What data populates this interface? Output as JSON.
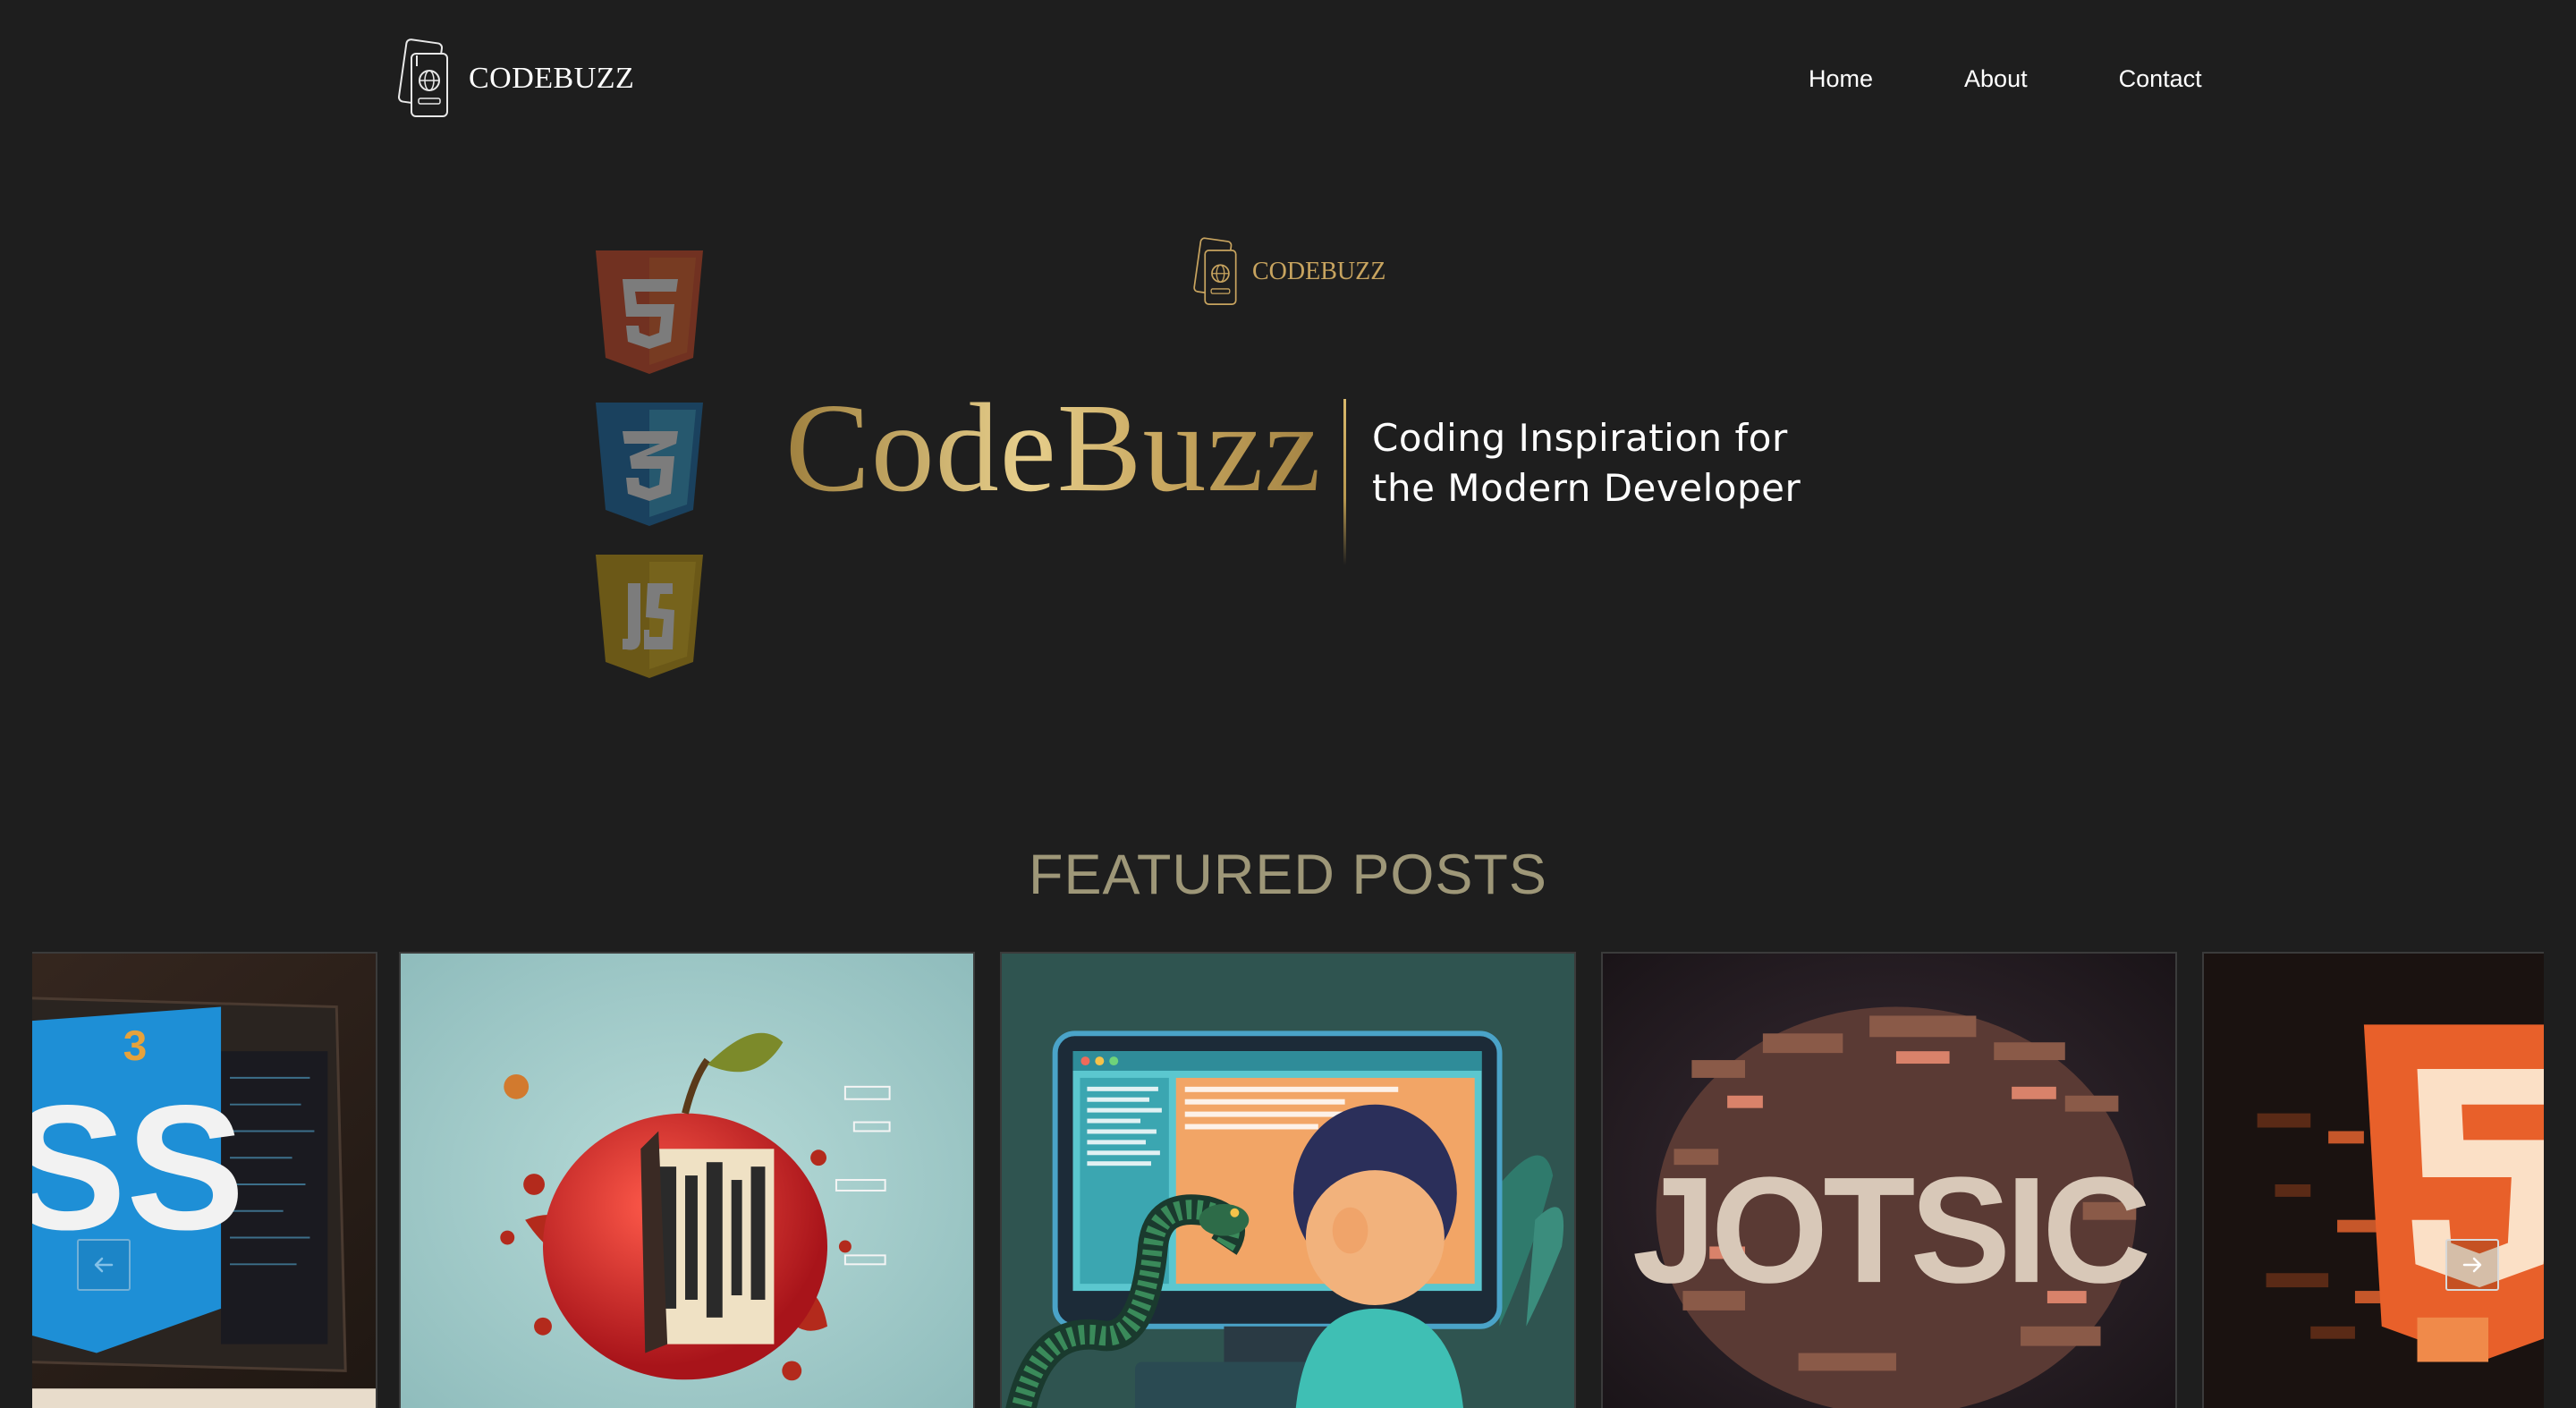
{
  "header": {
    "logo": {
      "word": "CODEBUZZ",
      "icon": "passport-globe-icon"
    },
    "nav": [
      {
        "label": "Home"
      },
      {
        "label": "About"
      },
      {
        "label": "Contact"
      }
    ]
  },
  "hero": {
    "small_logo": {
      "word": "CODEBUZZ",
      "icon": "passport-globe-icon"
    },
    "brand": "CodeBuzz",
    "tagline": [
      "Coding Inspiration for",
      "the Modern Developer"
    ],
    "badges": [
      {
        "icon": "html5-icon",
        "color": "#b8371f"
      },
      {
        "icon": "css3-icon",
        "color": "#1d4d9c"
      },
      {
        "icon": "js-icon",
        "color": "#b88a0f"
      }
    ]
  },
  "featured": {
    "title": "FEATURED POSTS",
    "posts": [
      {
        "image": "css3-3d-logo-artwork"
      },
      {
        "image": "apple-code-splash-artwork"
      },
      {
        "image": "boy-with-python-at-computer-artwork"
      },
      {
        "image": "pixel-javascript-artwork"
      },
      {
        "image": "pixel-html5-logo-artwork"
      }
    ],
    "controls": {
      "prev_icon": "arrow-left-icon",
      "next_icon": "arrow-right-icon"
    }
  },
  "colors": {
    "background": "#1e1e1e",
    "gold": "#c9a860",
    "featured_title": "#9e9778"
  }
}
